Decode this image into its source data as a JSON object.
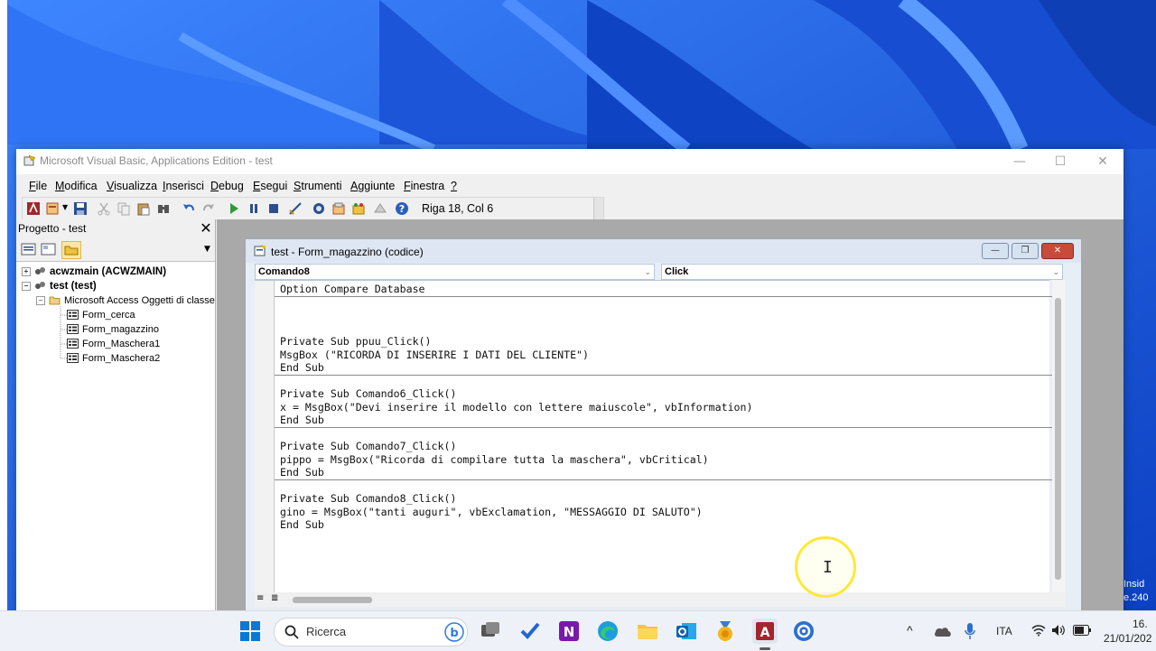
{
  "window": {
    "title": "Microsoft Visual Basic, Applications Edition - test",
    "controls": [
      "—",
      "☐",
      "✕"
    ]
  },
  "menu": [
    {
      "label": "File",
      "u": "F",
      "rest": "ile"
    },
    {
      "label": "Modifica",
      "u": "M",
      "rest": "odifica"
    },
    {
      "label": "Visualizza",
      "u": "V",
      "rest": "isualizza"
    },
    {
      "label": "Inserisci",
      "u": "I",
      "rest": "nserisci"
    },
    {
      "label": "Debug",
      "u": "D",
      "rest": "ebug"
    },
    {
      "label": "Esegui",
      "u": "E",
      "rest": "segui"
    },
    {
      "label": "Strumenti",
      "u": "S",
      "rest": "trumenti"
    },
    {
      "label": "Aggiunte",
      "u": "A",
      "rest": "ggiunte"
    },
    {
      "label": "Finestra",
      "u": "F",
      "rest": "inestra"
    },
    {
      "label": "?",
      "u": "?",
      "rest": ""
    }
  ],
  "toolbar": {
    "cursor_position": "Riga 18, Col 6",
    "icons": [
      "access-icon",
      "insert-module-icon",
      "save-icon",
      "cut-icon",
      "copy-icon",
      "paste-icon",
      "find-icon",
      "undo-icon",
      "redo-icon",
      "run-icon",
      "pause-icon",
      "reset-icon",
      "design-mode-icon",
      "project-explorer-icon",
      "properties-icon",
      "object-browser-icon",
      "toolbox-icon",
      "help-icon"
    ]
  },
  "project": {
    "title": "Progetto - test",
    "close": "✕",
    "tree": [
      {
        "label": "acwzmain (ACWZMAIN)",
        "level": 0,
        "bold": true,
        "expander": "+"
      },
      {
        "label": "test (test)",
        "level": 0,
        "bold": true,
        "expander": "−"
      },
      {
        "label": "Microsoft Access Oggetti di classe",
        "level": 1,
        "bold": false,
        "expander": "−"
      },
      {
        "label": "Form_cerca",
        "level": 2,
        "bold": false
      },
      {
        "label": "Form_magazzino",
        "level": 2,
        "bold": false
      },
      {
        "label": "Form_Maschera1",
        "level": 2,
        "bold": false
      },
      {
        "label": "Form_Maschera2",
        "level": 2,
        "bold": false
      }
    ]
  },
  "codewindow": {
    "title": "test - Form_magazzino (codice)",
    "object_combo": "Comando8",
    "proc_combo": "Click",
    "lines": [
      "Option Compare Database",
      "",
      "",
      "",
      "Private Sub ppuu_Click()",
      "MsgBox (\"RICORDA DI INSERIRE I DATI DEL CLIENTE\")",
      "End Sub",
      "",
      "Private Sub Comando6_Click()",
      "x = MsgBox(\"Devi inserire il modello con lettere maiuscole\", vbInformation)",
      "End Sub",
      "",
      "Private Sub Comando7_Click()",
      "pippo = MsgBox(\"Ricorda di compilare tutta la maschera\", vbCritical)",
      "End Sub",
      "",
      "Private Sub Comando8_Click()",
      "gino = MsgBox(\"tanti auguri\", vbExclamation, \"MESSAGGIO DI SALUTO\")",
      "End Sub"
    ],
    "separators_after": [
      0,
      6,
      10,
      14
    ]
  },
  "desktop": {
    "edge_text_1": "Insid",
    "edge_text_2": "e.240"
  },
  "taskbar": {
    "search_placeholder": "Ricerca",
    "language": "ITA",
    "time": "16.",
    "date": "21/01/202"
  }
}
